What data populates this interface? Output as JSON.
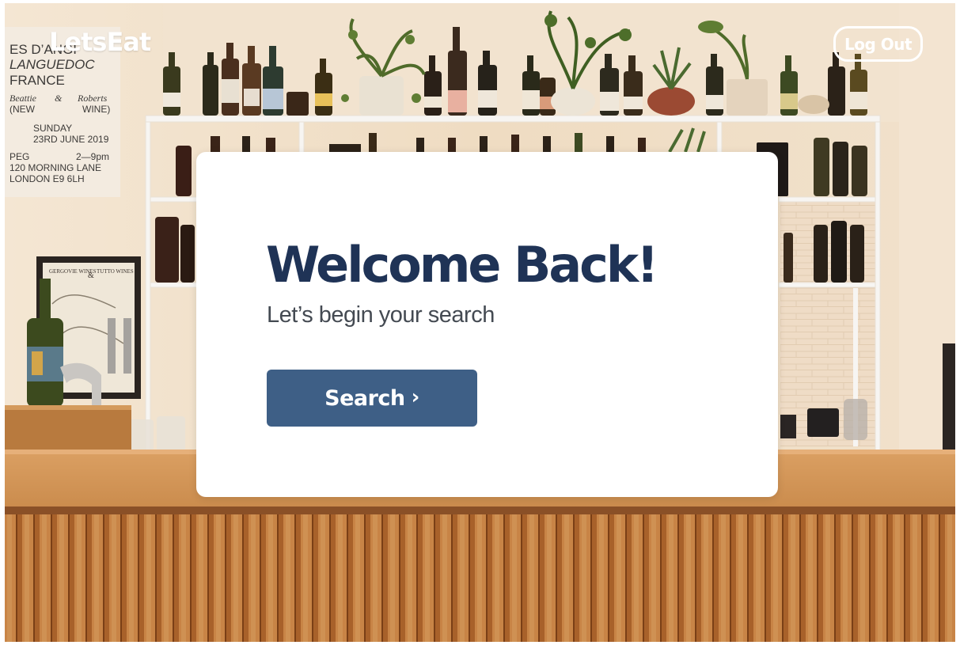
{
  "app": {
    "logo_text": "LetsEat",
    "logout_label": "Log Out"
  },
  "welcome": {
    "title": "Welcome Back!",
    "subtitle": "Let’s begin your search",
    "search_label": "Search",
    "search_chevron": "›"
  },
  "poster": {
    "line1": "ES D’ANGI",
    "line2": "LANGUEDOC",
    "line3": "FRANCE",
    "line4_left": "Beattie",
    "line4_amp": "&",
    "line4_right": "Roberts",
    "line5_left": "(NEW",
    "line5_right": "WINE)",
    "line6": "SUNDAY",
    "line7": "23RD JUNE 2019",
    "line8_left": "PEG",
    "line8_right": "2—9pm",
    "line9": "120 MORNING LANE",
    "line10": "LONDON E9 6LH"
  },
  "framed_picture": {
    "left_text": "GERGOVIE WINES",
    "amp": "&",
    "right_text": "TUTTO WINES"
  },
  "colors": {
    "brand_navy": "#1f3356",
    "button_blue": "#3e5f86",
    "card_bg": "#ffffff"
  },
  "icons": {
    "search_chevron": "chevron-right-icon"
  }
}
